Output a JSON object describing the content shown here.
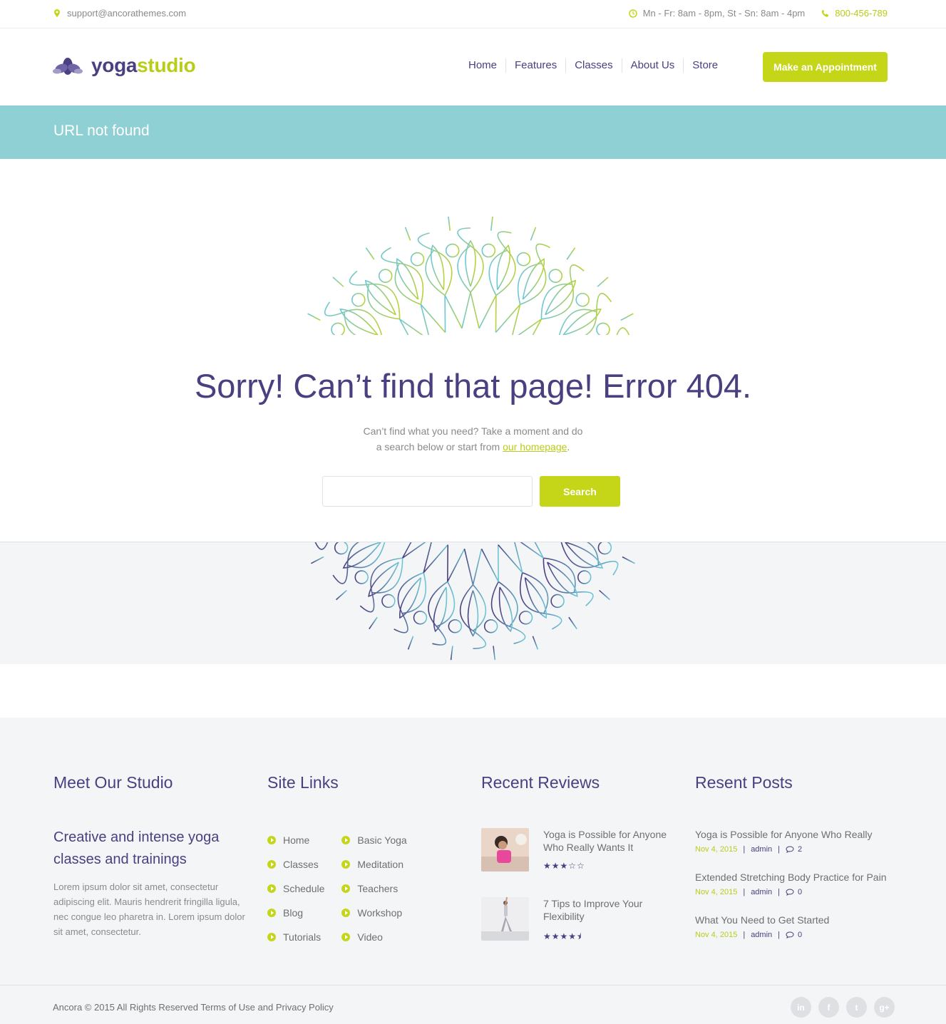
{
  "topbar": {
    "email": "support@ancorathemes.com",
    "hours": "Mn - Fr: 8am - 8pm, St - Sn: 8am - 4pm",
    "phone": "800-456-789",
    "icons": [
      "location-pin-icon",
      "clock-icon",
      "phone-icon"
    ]
  },
  "header": {
    "logo_part1": "yoga",
    "logo_part2": "studio",
    "nav": [
      "Home",
      "Features",
      "Classes",
      "About Us",
      "Store"
    ],
    "cta": "Make an Appointment"
  },
  "banner": {
    "title": "URL not found"
  },
  "error": {
    "title": "Sorry! Can’t find that page! Error 404.",
    "line1": "Can’t find what you need? Take a moment and do",
    "line2_prefix": "a search below or start from ",
    "link": "our homepage",
    "line2_suffix": ".",
    "search_value": "",
    "search_button": "Search"
  },
  "footer": {
    "studio": {
      "title": "Meet Our Studio",
      "subtitle": "Creative and intense yoga classes and trainings",
      "text": "Lorem ipsum dolor sit amet, consectetur adipiscing elit. Mauris hendrerit fringilla ligula, nec congue leo pharetra in. Lorem ipsum dolor sit amet, consectetur."
    },
    "links": {
      "title": "Site Links",
      "col1": [
        "Home",
        "Classes",
        "Schedule",
        "Blog",
        "Tutorials"
      ],
      "col2": [
        "Basic Yoga",
        "Meditation",
        "Teachers",
        "Workshop",
        "Video"
      ]
    },
    "reviews": {
      "title": "Recent Reviews",
      "items": [
        {
          "title": "Yoga is Possible for Anyone Who Really Wants It",
          "rating": 3,
          "stars": "★★★☆☆"
        },
        {
          "title": "7 Tips to Improve Your Flexibility",
          "rating": 4.5,
          "stars": "★★★★⯨"
        }
      ]
    },
    "posts": {
      "title": "Resent Posts",
      "items": [
        {
          "title": "Yoga is Possible for Anyone Who Really",
          "date": "Nov 4, 2015",
          "author": "admin",
          "comments": "2"
        },
        {
          "title": "Extended Stretching Body Practice for Pain",
          "date": "Nov 4, 2015",
          "author": "admin",
          "comments": "0"
        },
        {
          "title": "What You Need to Get Started",
          "date": "Nov 4, 2015",
          "author": "admin",
          "comments": "0"
        }
      ]
    }
  },
  "bottom": {
    "copyright": "Ancora © 2015 All Rights Reserved Terms of Use and Privacy Policy",
    "socials": [
      "in",
      "f",
      "t",
      "g+"
    ]
  },
  "colors": {
    "accent": "#c5d619",
    "brand": "#4a3f80",
    "banner": "#8ed0d4",
    "footer_bg": "#f4f5f7"
  }
}
